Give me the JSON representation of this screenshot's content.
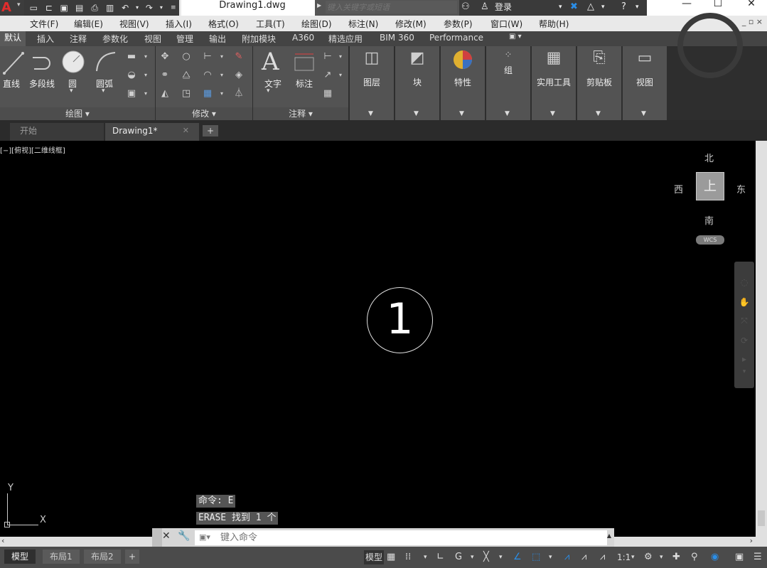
{
  "window": {
    "title": "Drawing1.dwg",
    "search_placeholder": "键入关键字或短语",
    "login": "登录",
    "minimize": "—",
    "maximize": "☐",
    "close": "✕"
  },
  "menu": [
    "文件(F)",
    "编辑(E)",
    "视图(V)",
    "插入(I)",
    "格式(O)",
    "工具(T)",
    "绘图(D)",
    "标注(N)",
    "修改(M)",
    "参数(P)",
    "窗口(W)",
    "帮助(H)"
  ],
  "menu_right": "_ ▫ ×",
  "ribbon_tabs": [
    "默认",
    "插入",
    "注释",
    "参数化",
    "视图",
    "管理",
    "输出",
    "附加模块",
    "A360",
    "精选应用",
    "BIM 360",
    "Performance"
  ],
  "ribbon_tab_extra": "▣ ▾",
  "draw_panel": {
    "title": "绘图 ▾",
    "tools": [
      "直线",
      "多段线",
      "圆",
      "圆弧"
    ]
  },
  "modify_panel": {
    "title": "修改 ▾"
  },
  "annotation_panel": {
    "title": "注释 ▾",
    "tools": [
      "文字",
      "标注"
    ]
  },
  "panels_right": [
    "图层",
    "块",
    "特性",
    "组",
    "实用工具",
    "剪贴板",
    "视图"
  ],
  "doc_tabs": [
    "开始",
    "Drawing1*"
  ],
  "doc_tab_add": "+",
  "doc_tab_close": "✕",
  "viewport": {
    "label": "[−][俯视][二维线框]",
    "shape_text": "1",
    "viewcube": {
      "north": "北",
      "south": "南",
      "east": "东",
      "west": "西",
      "top": "上",
      "wcs": "WCS"
    },
    "ucs_x": "X",
    "ucs_y": "Y"
  },
  "command_history": [
    "命令: E",
    "ERASE 找到 1 个"
  ],
  "command_prompt": "键入命令",
  "layout_tabs": [
    "模型",
    "布局1",
    "布局2"
  ],
  "layout_add": "+",
  "status": {
    "model": "模型",
    "scale": "1:1"
  }
}
